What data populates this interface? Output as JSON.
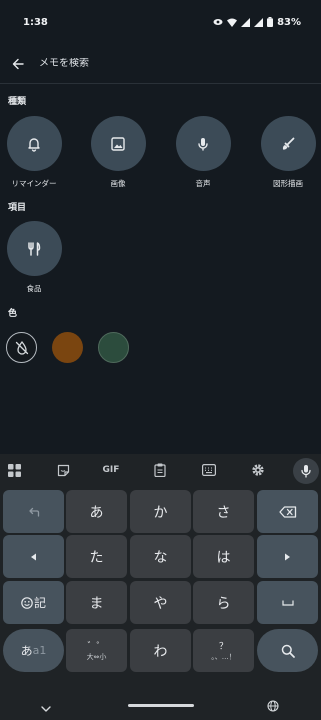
{
  "status": {
    "time": "1:38",
    "battery": "83%"
  },
  "header": {
    "search_placeholder": "メモを検索"
  },
  "sections": {
    "types": "種類",
    "items": "項目",
    "colors": "色"
  },
  "types": [
    {
      "label": "リマインダー",
      "icon": "bell-icon"
    },
    {
      "label": "画像",
      "icon": "image-icon"
    },
    {
      "label": "音声",
      "icon": "mic-icon"
    },
    {
      "label": "図形描画",
      "icon": "brush-icon"
    }
  ],
  "items": [
    {
      "label": "食品",
      "icon": "utensils-icon"
    }
  ],
  "colors": {
    "swatches": [
      "#14191e",
      "#7a4510",
      "#2c4c3d"
    ]
  },
  "keyboard": {
    "toolbar": {
      "gif": "GIF"
    },
    "keys": {
      "a": "あ",
      "ka": "か",
      "sa": "さ",
      "ta": "た",
      "na": "な",
      "ha": "は",
      "emoji_ki": "記",
      "ma": "ま",
      "ya": "や",
      "ra": "ら",
      "mode_a": "あ",
      "mode_a1": "a1",
      "dakuten_top": "゛゜",
      "dakuten_bottom": "大⇔小",
      "wa": "わ",
      "punct_top": "？",
      "punct_bottom": "。、…！"
    }
  }
}
